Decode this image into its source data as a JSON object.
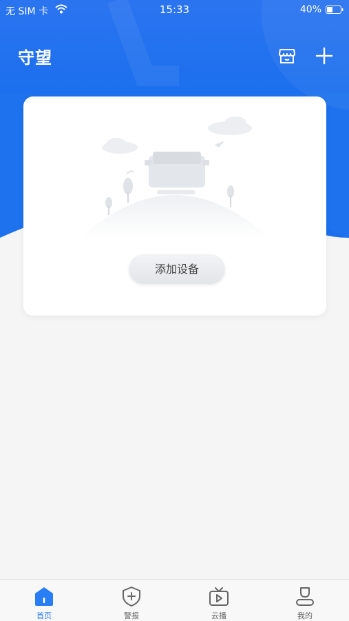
{
  "status_bar": {
    "carrier": "无 SIM 卡",
    "time": "15:33",
    "battery": "40%"
  },
  "header": {
    "title": "守望",
    "store_icon": "store-icon",
    "add_icon": "plus-icon"
  },
  "card": {
    "empty_illustration": "no-device-illustration",
    "add_device_label": "添加设备"
  },
  "tabbar": {
    "items": [
      {
        "label": "首页",
        "icon": "home-icon",
        "active": true
      },
      {
        "label": "警报",
        "icon": "shield-plus-icon",
        "active": false
      },
      {
        "label": "云播",
        "icon": "tv-play-icon",
        "active": false
      },
      {
        "label": "我的",
        "icon": "user-icon",
        "active": false
      }
    ]
  },
  "colors": {
    "primary": "#2a7ef5",
    "header_blue": "#1f73ee",
    "background": "#f5f5f6"
  }
}
